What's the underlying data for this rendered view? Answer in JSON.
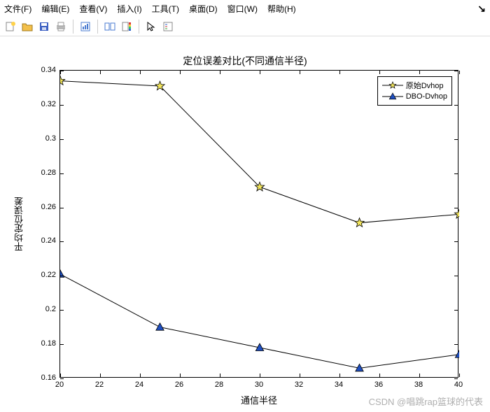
{
  "menu": {
    "file": "文件(F)",
    "edit": "编辑(E)",
    "view": "查看(V)",
    "insert": "插入(I)",
    "tools": "工具(T)",
    "desktop": "桌面(D)",
    "window": "窗口(W)",
    "help": "帮助(H)"
  },
  "toolbar_icons": {
    "new": "new-figure-icon",
    "open": "open-icon",
    "save": "save-icon",
    "print": "print-icon",
    "edit_plot": "edit-plot-icon",
    "link": "link-icon",
    "colorbar": "colorbar-icon",
    "pointer": "pointer-icon",
    "insert_legend": "legend-icon"
  },
  "chart_data": {
    "type": "line",
    "title": "定位误差对比(不同通信半径)",
    "xlabel": "通信半径",
    "ylabel": "平均定位误差",
    "xlim": [
      20,
      40
    ],
    "ylim": [
      0.16,
      0.34
    ],
    "xticks": [
      20,
      22,
      24,
      26,
      28,
      30,
      32,
      34,
      36,
      38,
      40
    ],
    "yticks": [
      0.16,
      0.18,
      0.2,
      0.22,
      0.24,
      0.26,
      0.28,
      0.3,
      0.32,
      0.34
    ],
    "series": [
      {
        "name": "原始Dvhop",
        "marker": "pentagram",
        "color": "#000000",
        "marker_face": "#f2e55c",
        "x": [
          20,
          25,
          30,
          35,
          40
        ],
        "y": [
          0.334,
          0.331,
          0.272,
          0.251,
          0.256
        ]
      },
      {
        "name": "DBO-Dvhop",
        "marker": "triangle",
        "color": "#000000",
        "marker_face": "#1e4fc2",
        "x": [
          20,
          25,
          30,
          35,
          40
        ],
        "y": [
          0.221,
          0.19,
          0.178,
          0.166,
          0.174
        ]
      }
    ],
    "legend_position": "top-right"
  },
  "watermark": "CSDN @唱跳rap篮球的代表"
}
